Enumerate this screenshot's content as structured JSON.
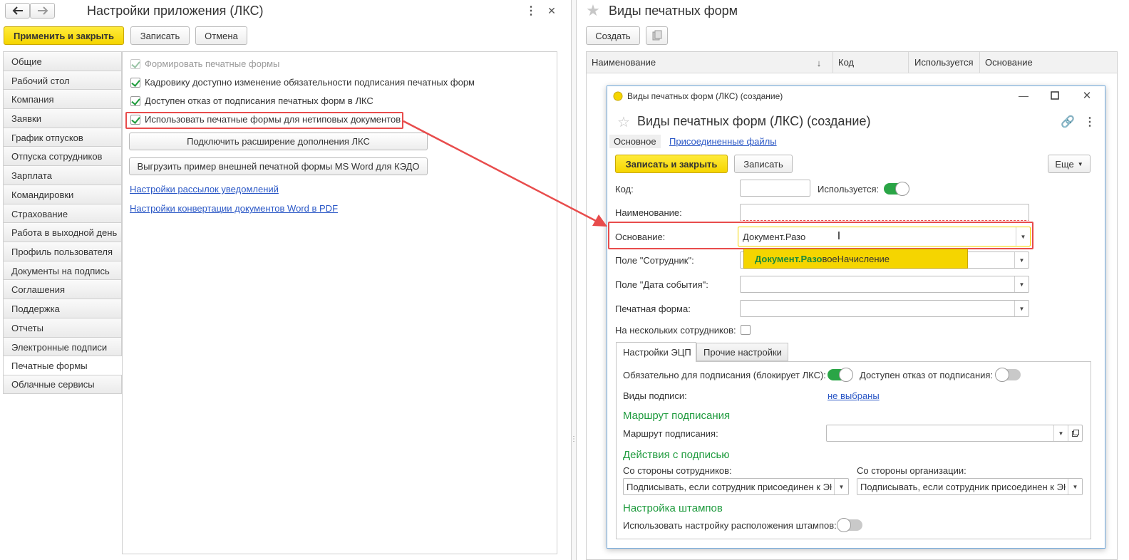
{
  "left": {
    "title": "Настройки приложения (ЛКС)",
    "buttons": {
      "apply": "Применить и закрыть",
      "save": "Записать",
      "cancel": "Отмена"
    },
    "nav": [
      "Общие",
      "Рабочий стол",
      "Компания",
      "Заявки",
      "График отпусков",
      "Отпуска сотрудников",
      "Зарплата",
      "Командировки",
      "Страхование",
      "Работа в выходной день",
      "Профиль пользователя",
      "Документы на подпись",
      "Соглашения",
      "Поддержка",
      "Отчеты",
      "Электронные подписи",
      "Печатные формы",
      "Облачные сервисы"
    ],
    "active_nav": "Печатные формы",
    "checkboxes": [
      {
        "label": "Формировать печатные формы",
        "checked": true
      },
      {
        "label": "Кадровику доступно изменение обязательности подписания печатных форм",
        "checked": true
      },
      {
        "label": "Доступен отказ от подписания печатных форм в ЛКС",
        "checked": true
      },
      {
        "label": "Использовать печатные формы для нетиповых документов",
        "checked": true
      }
    ],
    "connect_button": "Подключить расширение дополнения ЛКС",
    "export_button": "Выгрузить пример внешней печатной формы MS Word для КЭДО",
    "links": [
      "Настройки рассылок уведомлений",
      "Настройки конвертации документов Word в PDF"
    ]
  },
  "right": {
    "title": "Виды печатных форм",
    "create_button": "Создать",
    "columns": [
      "Наименование",
      "Код",
      "Используется",
      "Основание"
    ]
  },
  "dialog": {
    "window_title": "Виды печатных форм (ЛКС) (создание)",
    "form_title": "Виды печатных форм (ЛКС) (создание)",
    "tabs": {
      "main": "Основное",
      "files": "Присоединенные файлы"
    },
    "buttons": {
      "save_close": "Записать и закрыть",
      "save": "Записать",
      "more": "Еще"
    },
    "labels": {
      "code": "Код:",
      "used": "Используется:",
      "name": "Наименование:",
      "basis": "Основание:",
      "employee_field": "Поле \"Сотрудник\":",
      "event_date_field": "Поле \"Дата события\":",
      "print_form": "Печатная форма:",
      "multi": "На нескольких сотрудников:"
    },
    "basis_value": "Документ.Разо",
    "autocomplete": {
      "match": "Документ.Разо",
      "rest": "воеНачисление"
    },
    "inner_tabs": {
      "ecp": "Настройки ЭЦП",
      "other": "Прочие настройки"
    },
    "ecp": {
      "required_label": "Обязательно для подписания (блокирует ЛКС):",
      "refuse_label": "Доступен отказ от подписания:",
      "sign_types_label": "Виды подписи:",
      "sign_types_value": "не выбраны",
      "route_section": "Маршрут подписания",
      "route_label": "Маршрут подписания:",
      "actions_section": "Действия с подписью",
      "employees_label": "Со стороны сотрудников:",
      "org_label": "Со стороны организации:",
      "employees_value": "Подписывать, если сотрудник присоединен к ЭК",
      "org_value": "Подписывать, если сотрудник присоединен к ЭК",
      "stamps_section": "Настройка штампов",
      "stamps_label": "Использовать настройку расположения штампов:"
    }
  },
  "colors": {
    "accent_yellow": "#f5d500",
    "green": "#1f9b3e",
    "link": "#2a57c6",
    "highlight": "#e84c4c"
  }
}
